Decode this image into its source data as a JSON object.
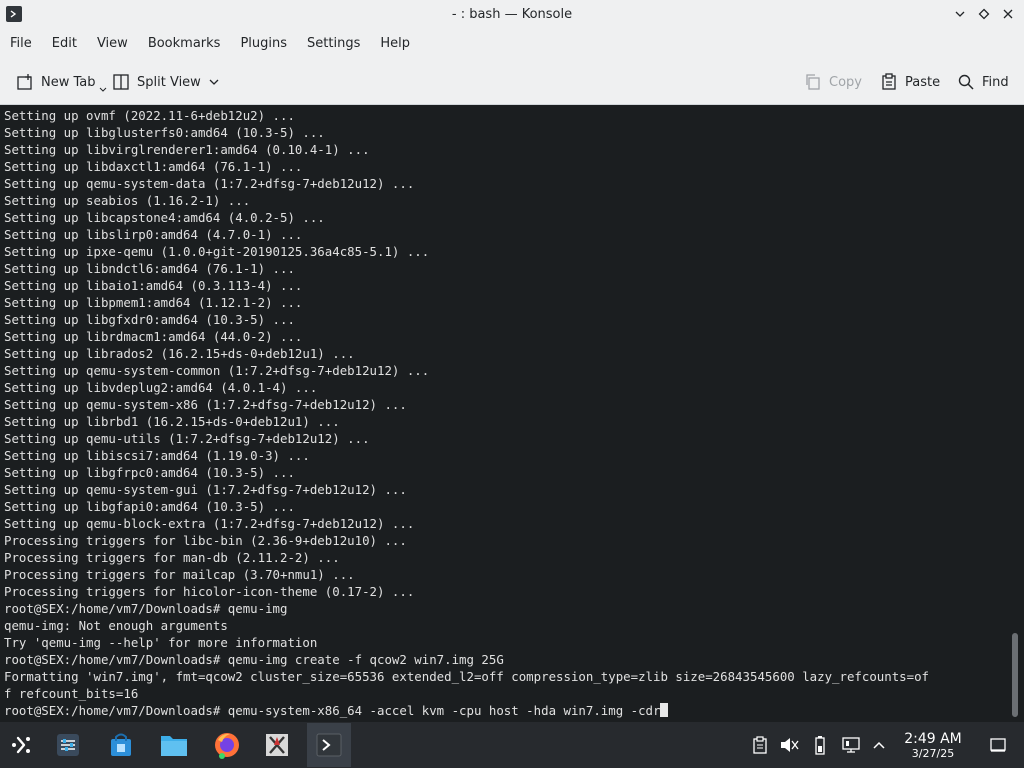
{
  "window": {
    "title": "- : bash — Konsole"
  },
  "menubar": {
    "items": [
      "File",
      "Edit",
      "View",
      "Bookmarks",
      "Plugins",
      "Settings",
      "Help"
    ]
  },
  "toolbar": {
    "new_tab": "New Tab",
    "split_view": "Split View",
    "copy": "Copy",
    "paste": "Paste",
    "find": "Find"
  },
  "terminal": {
    "lines": [
      "Setting up ovmf (2022.11-6+deb12u2) ...",
      "Setting up libglusterfs0:amd64 (10.3-5) ...",
      "Setting up libvirglrenderer1:amd64 (0.10.4-1) ...",
      "Setting up libdaxctl1:amd64 (76.1-1) ...",
      "Setting up qemu-system-data (1:7.2+dfsg-7+deb12u12) ...",
      "Setting up seabios (1.16.2-1) ...",
      "Setting up libcapstone4:amd64 (4.0.2-5) ...",
      "Setting up libslirp0:amd64 (4.7.0-1) ...",
      "Setting up ipxe-qemu (1.0.0+git-20190125.36a4c85-5.1) ...",
      "Setting up libndctl6:amd64 (76.1-1) ...",
      "Setting up libaio1:amd64 (0.3.113-4) ...",
      "Setting up libpmem1:amd64 (1.12.1-2) ...",
      "Setting up libgfxdr0:amd64 (10.3-5) ...",
      "Setting up librdmacm1:amd64 (44.0-2) ...",
      "Setting up librados2 (16.2.15+ds-0+deb12u1) ...",
      "Setting up qemu-system-common (1:7.2+dfsg-7+deb12u12) ...",
      "Setting up libvdeplug2:amd64 (4.0.1-4) ...",
      "Setting up qemu-system-x86 (1:7.2+dfsg-7+deb12u12) ...",
      "Setting up librbd1 (16.2.15+ds-0+deb12u1) ...",
      "Setting up qemu-utils (1:7.2+dfsg-7+deb12u12) ...",
      "Setting up libiscsi7:amd64 (1.19.0-3) ...",
      "Setting up libgfrpc0:amd64 (10.3-5) ...",
      "Setting up qemu-system-gui (1:7.2+dfsg-7+deb12u12) ...",
      "Setting up libgfapi0:amd64 (10.3-5) ...",
      "Setting up qemu-block-extra (1:7.2+dfsg-7+deb12u12) ...",
      "Processing triggers for libc-bin (2.36-9+deb12u10) ...",
      "Processing triggers for man-db (2.11.2-2) ...",
      "Processing triggers for mailcap (3.70+nmu1) ...",
      "Processing triggers for hicolor-icon-theme (0.17-2) ...",
      "root@SEX:/home/vm7/Downloads# qemu-img",
      "qemu-img: Not enough arguments",
      "Try 'qemu-img --help' for more information",
      "root@SEX:/home/vm7/Downloads# qemu-img create -f qcow2 win7.img 25G",
      "Formatting 'win7.img', fmt=qcow2 cluster_size=65536 extended_l2=off compression_type=zlib size=26843545600 lazy_refcounts=of",
      "f refcount_bits=16"
    ],
    "current_line": "root@SEX:/home/vm7/Downloads# qemu-system-x86_64 -accel kvm -cpu host -hda win7.img -cdr"
  },
  "taskbar": {
    "clock_time": "2:49 AM",
    "clock_date": "3/27/25",
    "apps": [
      "app-launcher",
      "system-settings",
      "discover",
      "dolphin",
      "firefox",
      "xwayland",
      "konsole"
    ]
  },
  "colors": {
    "terminal_bg": "#1b1e20",
    "terminal_fg": "#e0e0e0",
    "panel_bg": "#272a2e",
    "chrome_bg": "#eff0f1",
    "accent": "#3daee9"
  }
}
